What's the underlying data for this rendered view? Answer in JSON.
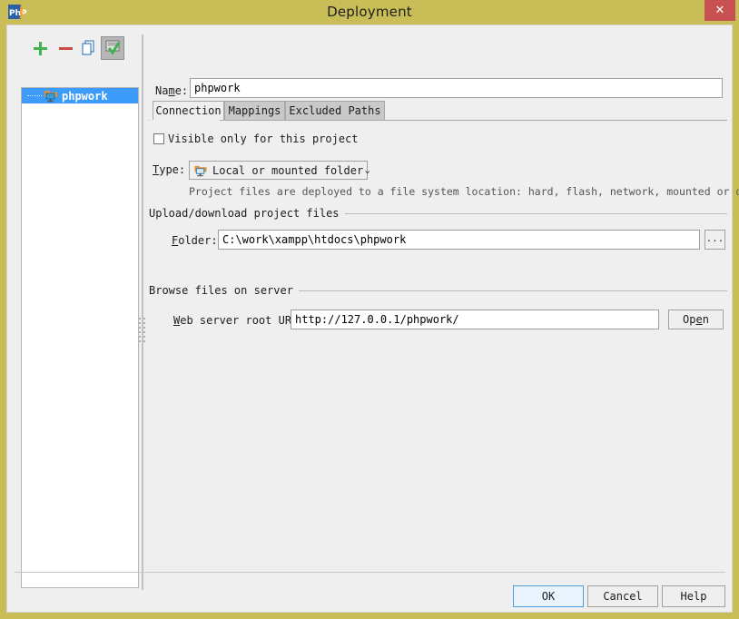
{
  "window": {
    "title": "Deployment",
    "app_icon": "phpstorm-icon",
    "close_label": "✕",
    "titlebar_color": "#c9bd57",
    "close_button_color": "#c75050"
  },
  "toolbar": {
    "add_label": "+",
    "remove_label": "−",
    "copy_label": "copy-icon",
    "autodetect_label": "autodetect-icon"
  },
  "tree": {
    "items": [
      {
        "label": "phpwork",
        "icon": "local-folder-server-icon",
        "selected": true
      }
    ],
    "selected_color": "#3d9bfa"
  },
  "form": {
    "name_label_pre": "Na",
    "name_label_mn": "m",
    "name_label_post": "e:",
    "name_value": "phpwork",
    "name_placeholder": "",
    "visible_only_label": "Visible only for this project",
    "visible_only_checked": false,
    "type_label_mn": "T",
    "type_label_post": "ype:",
    "type_value": "Local or mounted folder",
    "type_icon": "local-folder-server-icon",
    "type_arrow": "⌄",
    "type_description": "Project files are deployed to a file system location: hard, flash, network, mounted or other drive.",
    "upload_section_label": "Upload/download project files",
    "folder_label_mn": "F",
    "folder_label_post": "older:",
    "folder_value": "C:\\work\\xampp\\htdocs\\phpwork",
    "folder_browse_label": "...",
    "browse_section_label": "Browse files on server",
    "url_label_mn": "W",
    "url_label_post": "eb server root URL:",
    "url_value": "http://127.0.0.1/phpwork/",
    "open_pre": "Op",
    "open_mn": "e",
    "open_post": "n"
  },
  "tabs": [
    {
      "label": "Connection",
      "active": true
    },
    {
      "label": "Mappings",
      "active": false
    },
    {
      "label": "Excluded Paths",
      "active": false
    }
  ],
  "buttons": {
    "ok": "OK",
    "cancel": "Cancel",
    "help": "Help"
  }
}
